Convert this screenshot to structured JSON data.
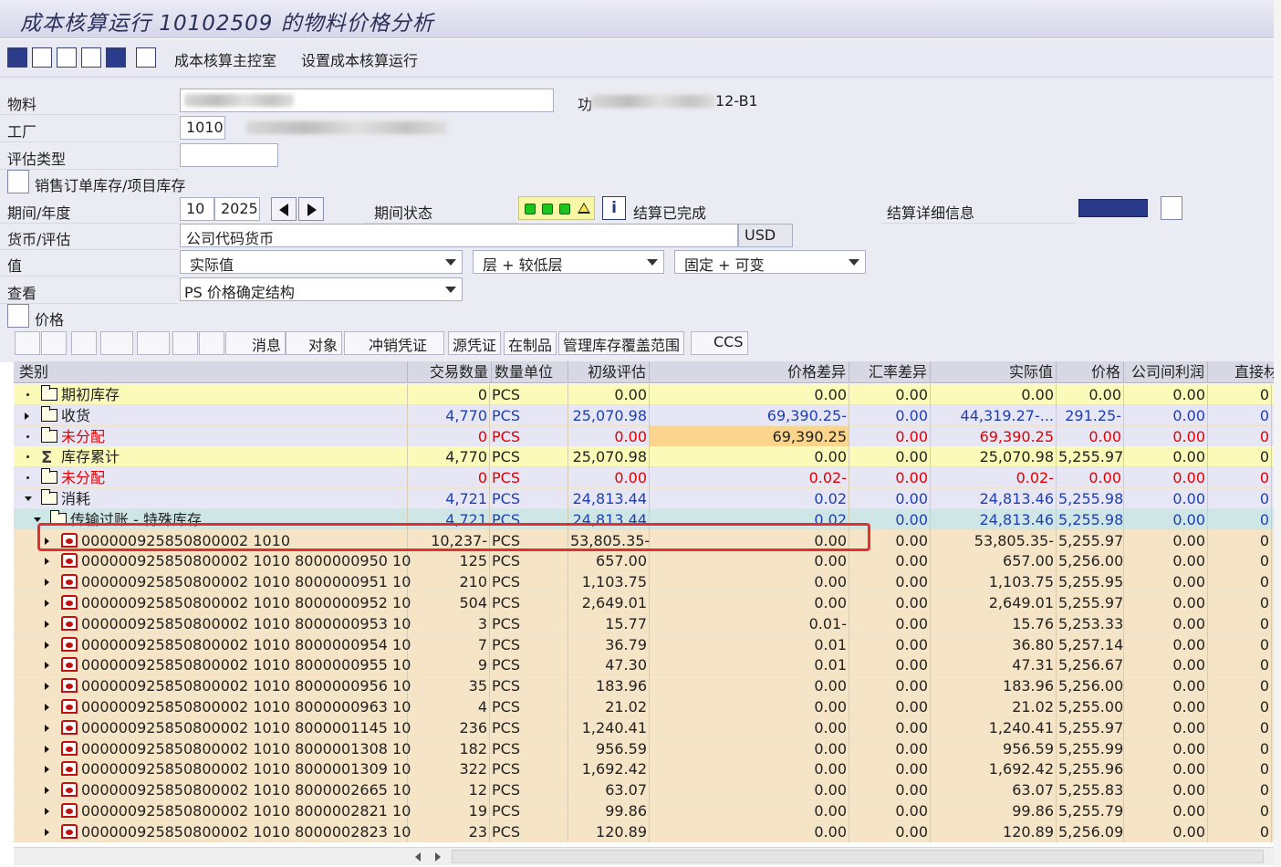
{
  "window": {
    "title": "成本核算运行 10102509 的物料价格分析"
  },
  "toolbar": {
    "menu1": "成本核算主控室",
    "menu2": "设置成本核算运行"
  },
  "form": {
    "material_label": "物料",
    "plant_label": "工厂",
    "plant_value": "1010",
    "valtype_label": "评估类型",
    "material_suffix": "12-B1",
    "material_suffix_prefix": "功",
    "sales_stock_label": "销售订单库存/项目库存",
    "period_label": "期间/年度",
    "period_value": "10",
    "year_value": "2025",
    "period_status_label": "期间状态",
    "settle_status": "结算已完成",
    "settle_detail_label": "结算详细信息",
    "currency_label": "货币/评估",
    "currency_type": "公司代码货币",
    "currency_value": "USD",
    "value_label": "值",
    "value_select": "实际值",
    "layer_select": "层 + 较低层",
    "fixvar_select": "固定 + 可变",
    "view_label": "查看",
    "view_select": "PS 价格确定结构",
    "price_section_label": "价格"
  },
  "alv_toolbar": {
    "msg": "消息",
    "obj": "对象",
    "reversal": "冲销凭证",
    "source": "源凭证",
    "wip": "在制品",
    "coverage": "管理库存覆盖范围",
    "ccs": "CCS"
  },
  "columns": {
    "category": "类别",
    "qty": "交易数量",
    "unit": "数量单位",
    "prelim": "初级评估",
    "pricediff": "价格差异",
    "exdiff": "汇率差异",
    "actual": "实际值",
    "price": "价格",
    "icprofit": "公司间利润",
    "direct": "直接材"
  },
  "rows": [
    {
      "name": "期初库存",
      "qty": "0",
      "unit": "PCS",
      "prelim": "0.00",
      "pricediff": "0.00",
      "exdiff": "0.00",
      "actual": "0.00",
      "price": "0.00",
      "icprofit": "0.00",
      "direct": "0"
    },
    {
      "name": "收货",
      "qty": "4,770",
      "unit": "PCS",
      "prelim": "25,070.98",
      "pricediff": "69,390.25-",
      "exdiff": "0.00",
      "actual": "44,319.27-...",
      "price": "291.25-",
      "icprofit": "0.00",
      "direct": "0"
    },
    {
      "name": "未分配",
      "qty": "0",
      "unit": "PCS",
      "prelim": "0.00",
      "pricediff": "69,390.25",
      "exdiff": "0.00",
      "actual": "69,390.25",
      "price": "0.00",
      "icprofit": "0.00",
      "direct": "0"
    },
    {
      "name": "库存累计",
      "qty": "4,770",
      "unit": "PCS",
      "prelim": "25,070.98",
      "pricediff": "0.00",
      "exdiff": "0.00",
      "actual": "25,070.98",
      "price": "5,255.97",
      "icprofit": "0.00",
      "direct": "0"
    },
    {
      "name": "未分配",
      "qty": "0",
      "unit": "PCS",
      "prelim": "0.00",
      "pricediff": "0.02-",
      "exdiff": "0.00",
      "actual": "0.02-",
      "price": "0.00",
      "icprofit": "0.00",
      "direct": "0"
    },
    {
      "name": "消耗",
      "qty": "4,721",
      "unit": "PCS",
      "prelim": "24,813.44",
      "pricediff": "0.02",
      "exdiff": "0.00",
      "actual": "24,813.46",
      "price": "5,255.98",
      "icprofit": "0.00",
      "direct": "0"
    },
    {
      "name": "传输过账 - 特殊库存",
      "qty": "4,721",
      "unit": "PCS",
      "prelim": "24,813.44",
      "pricediff": "0.02",
      "exdiff": "0.00",
      "actual": "24,813.46",
      "price": "5,255.98",
      "icprofit": "0.00",
      "direct": "0"
    },
    {
      "name": "000000925850800002 1010",
      "qty": "10,237-",
      "unit": "PCS",
      "prelim": "53,805.35-",
      "pricediff": "0.00",
      "exdiff": "0.00",
      "actual": "53,805.35-",
      "price": "5,255.97",
      "icprofit": "0.00",
      "direct": "0"
    },
    {
      "name": "000000925850800002 1010 8000000950 10",
      "qty": "125",
      "unit": "PCS",
      "prelim": "657.00",
      "pricediff": "0.00",
      "exdiff": "0.00",
      "actual": "657.00",
      "price": "5,256.00",
      "icprofit": "0.00",
      "direct": "0"
    },
    {
      "name": "000000925850800002 1010 8000000951 10",
      "qty": "210",
      "unit": "PCS",
      "prelim": "1,103.75",
      "pricediff": "0.00",
      "exdiff": "0.00",
      "actual": "1,103.75",
      "price": "5,255.95",
      "icprofit": "0.00",
      "direct": "0"
    },
    {
      "name": "000000925850800002 1010 8000000952 10",
      "qty": "504",
      "unit": "PCS",
      "prelim": "2,649.01",
      "pricediff": "0.00",
      "exdiff": "0.00",
      "actual": "2,649.01",
      "price": "5,255.97",
      "icprofit": "0.00",
      "direct": "0"
    },
    {
      "name": "000000925850800002 1010 8000000953 10",
      "qty": "3",
      "unit": "PCS",
      "prelim": "15.77",
      "pricediff": "0.01-",
      "exdiff": "0.00",
      "actual": "15.76",
      "price": "5,253.33",
      "icprofit": "0.00",
      "direct": "0"
    },
    {
      "name": "000000925850800002 1010 8000000954 10",
      "qty": "7",
      "unit": "PCS",
      "prelim": "36.79",
      "pricediff": "0.01",
      "exdiff": "0.00",
      "actual": "36.80",
      "price": "5,257.14",
      "icprofit": "0.00",
      "direct": "0"
    },
    {
      "name": "000000925850800002 1010 8000000955 10",
      "qty": "9",
      "unit": "PCS",
      "prelim": "47.30",
      "pricediff": "0.01",
      "exdiff": "0.00",
      "actual": "47.31",
      "price": "5,256.67",
      "icprofit": "0.00",
      "direct": "0"
    },
    {
      "name": "000000925850800002 1010 8000000956 10",
      "qty": "35",
      "unit": "PCS",
      "prelim": "183.96",
      "pricediff": "0.00",
      "exdiff": "0.00",
      "actual": "183.96",
      "price": "5,256.00",
      "icprofit": "0.00",
      "direct": "0"
    },
    {
      "name": "000000925850800002 1010 8000000963 10",
      "qty": "4",
      "unit": "PCS",
      "prelim": "21.02",
      "pricediff": "0.00",
      "exdiff": "0.00",
      "actual": "21.02",
      "price": "5,255.00",
      "icprofit": "0.00",
      "direct": "0"
    },
    {
      "name": "000000925850800002 1010 8000001145 10",
      "qty": "236",
      "unit": "PCS",
      "prelim": "1,240.41",
      "pricediff": "0.00",
      "exdiff": "0.00",
      "actual": "1,240.41",
      "price": "5,255.97",
      "icprofit": "0.00",
      "direct": "0"
    },
    {
      "name": "000000925850800002 1010 8000001308 10",
      "qty": "182",
      "unit": "PCS",
      "prelim": "956.59",
      "pricediff": "0.00",
      "exdiff": "0.00",
      "actual": "956.59",
      "price": "5,255.99",
      "icprofit": "0.00",
      "direct": "0"
    },
    {
      "name": "000000925850800002 1010 8000001309 10",
      "qty": "322",
      "unit": "PCS",
      "prelim": "1,692.42",
      "pricediff": "0.00",
      "exdiff": "0.00",
      "actual": "1,692.42",
      "price": "5,255.96",
      "icprofit": "0.00",
      "direct": "0"
    },
    {
      "name": "000000925850800002 1010 8000002665 10",
      "qty": "12",
      "unit": "PCS",
      "prelim": "63.07",
      "pricediff": "0.00",
      "exdiff": "0.00",
      "actual": "63.07",
      "price": "5,255.83",
      "icprofit": "0.00",
      "direct": "0"
    },
    {
      "name": "000000925850800002 1010 8000002821 10",
      "qty": "19",
      "unit": "PCS",
      "prelim": "99.86",
      "pricediff": "0.00",
      "exdiff": "0.00",
      "actual": "99.86",
      "price": "5,255.79",
      "icprofit": "0.00",
      "direct": "0"
    },
    {
      "name": "000000925850800002 1010 8000002823 10",
      "qty": "23",
      "unit": "PCS",
      "prelim": "120.89",
      "pricediff": "0.00",
      "exdiff": "0.00",
      "actual": "120.89",
      "price": "5,256.09",
      "icprofit": "0.00",
      "direct": "0"
    }
  ],
  "colors": {
    "yellow_row": "#fbfab8",
    "lavender_row": "#e6e6f5",
    "teal_row": "#cfe6e6",
    "item_row": "#f6e4c6",
    "highlight_cell": "#fbd58c",
    "red_text": "#e00000",
    "blue_text": "#1f3fb0",
    "box": "#e03030"
  }
}
